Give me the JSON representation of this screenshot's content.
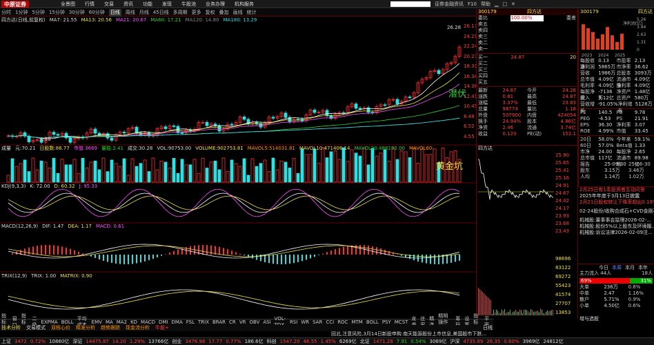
{
  "app": {
    "logo": "中原证券",
    "menu": [
      "全景图",
      "行情",
      "交易",
      "资讯",
      "功能",
      "发现",
      "牛股池",
      "业务办理",
      "机构服务"
    ],
    "top_right": [
      "证券金融资讯",
      "F10",
      "帮助"
    ]
  },
  "periods": [
    "分时",
    "1分钟",
    "5分钟",
    "15分钟",
    "30分钟",
    "60分钟",
    "日线",
    "周线",
    "月线",
    "45日线",
    "多周期",
    "更多",
    "复权",
    "叠加",
    "画线",
    "统计"
  ],
  "active_period": "日线",
  "main_chart": {
    "stock_label": "四方达(日线,前复权)",
    "ma": [
      {
        "label": "MA7: 21.55",
        "color": "#ffffff"
      },
      {
        "label": "MA13: 20.56",
        "color": "#f0e040"
      },
      {
        "label": "MA21: 20.67",
        "color": "#ff50ff"
      },
      {
        "label": "MA60: 17.21",
        "color": "#30d030"
      },
      {
        "label": "MA120: 14.80",
        "color": "#888888"
      },
      {
        "label": "MA180: 13.29",
        "color": "#30d8e0"
      }
    ],
    "high_label": "26.28",
    "low_label": "4.16",
    "annotation": "潜伏",
    "price_axis": [
      "26.17",
      "24.21",
      "22.24",
      "20.27",
      "18.31",
      "16.34",
      "14.38",
      "12.41",
      "10.45",
      "8.48",
      "6.52",
      "4.55"
    ]
  },
  "volume_chart": {
    "title_items": [
      "成量",
      "元:70.21",
      "日股数:86.77",
      "市值:3669",
      "量能:2.41",
      "成交:30.28",
      "VOL:90753.00",
      "VOLUME:902753.81",
      "MAVOL5:514031.81",
      "MAVOL10:471406.14",
      "MAVOL20:486192.00",
      "MAVOL60:"
    ],
    "annotation": "黄金坑"
  },
  "kdj_chart": {
    "title_items": [
      "KDJ(9,3,3)",
      "K: 72.00",
      "D: 60.32",
      "J: 95.33"
    ]
  },
  "macd_chart": {
    "title_items": [
      "MACD(12,26,9)",
      "DIF: 1.47",
      "DEA: 1.17",
      "MACD: 0.61"
    ]
  },
  "trix_chart": {
    "title_items": [
      "TRIX(12,9)",
      "TRIX: 1.00",
      "MATRIX: 0.90"
    ]
  },
  "quote_panel": {
    "code": "300179",
    "name": "四方达",
    "order_ratio_label": "委比",
    "order_ratio": "100.00%",
    "order_diff_label": "委差",
    "ask_labels": [
      "卖五",
      "卖四",
      "卖三",
      "卖二",
      "卖一"
    ],
    "bid_labels": [
      "买一",
      "买二",
      "买三",
      "买四",
      "买五"
    ],
    "bid_one_price": "24.87",
    "bid_one_vol": "20",
    "stats": [
      [
        "最新",
        "24.87",
        "今开",
        "24.28"
      ],
      [
        "涨跌",
        "0.81",
        "最高",
        "24.87"
      ],
      [
        "涨幅",
        "3.37%",
        "最低",
        "23.83"
      ],
      [
        "总量",
        "98774",
        "量比",
        "1.18"
      ],
      [
        "外盘",
        "507900",
        "内盘",
        "424054"
      ],
      [
        "换手",
        "24.94%",
        "股本",
        "4.86亿"
      ],
      [
        "净资",
        "2.46",
        "流通",
        "3.74亿"
      ],
      [
        "收益",
        "0.120",
        "PE(动)",
        "152.1"
      ]
    ]
  },
  "intraday": {
    "title": "四方达",
    "price_axis": [
      "25.90",
      "25.65",
      "25.41",
      "25.16",
      "24.91",
      "24.67",
      "24.42",
      "24.17",
      "23.93",
      "23.68",
      "23.43"
    ],
    "vol_axis": [
      "98696",
      "83122",
      "69272",
      "55423",
      "41574",
      "27707",
      "13853"
    ]
  },
  "news_panel": {
    "items": [
      "2月25日有1条投资者互动问答",
      "2025年年度于3月13日披露",
      "2月21日股权转让下降率超出0.19%...",
      "02-24股份/收购合成石+CVD金刚石...",
      "机械股:董事事会监理2026-02-...",
      "机械股:股份5%以上股东及环境履...",
      "机械股:诉讼法律2026-02-09注..."
    ]
  },
  "far_right": {
    "code": "300179",
    "name": "四方达",
    "bar_years": [
      "2023",
      "2024",
      "2025"
    ],
    "bar_label": "净利润(亿)",
    "bar_axis": [
      "5.26",
      "3.94",
      "2.63",
      "1.31",
      "0"
    ],
    "stats": [
      [
        "每股收益",
        "0.13",
        "市盈率",
        "2.13"
      ],
      [
        "净利润",
        "5865万",
        "市净率",
        "36.62"
      ],
      [
        "营收",
        "1986万",
        "总股本",
        "3093万"
      ],
      [
        "总市值",
        "4.09亿",
        "流通市值",
        "4.09亿"
      ],
      [
        "毛利率",
        "4.09亿",
        "净利率",
        "4.09亿"
      ],
      [
        "每股净资",
        "-7136万",
        "净资产",
        "1.48亿"
      ],
      [
        "收入",
        "9.12亿",
        "总资产",
        "580万"
      ],
      [
        "营收增长",
        "-91.05%",
        "净利增长",
        "5128万"
      ]
    ],
    "valuation": [
      [
        "PE",
        "140.5",
        "PB",
        "9.78"
      ],
      [
        "PEG",
        "-4.53",
        "PS",
        "21.91"
      ],
      [
        "EPS",
        "36.30",
        "净利率",
        "3.07"
      ],
      [
        "ROE",
        "4.99%",
        "市值",
        "33.45"
      ]
    ],
    "holder_stats": [
      [
        "20日",
        "58.0%",
        "今年来",
        "59.1%"
      ],
      [
        "60日",
        "57.0%",
        "Beta值",
        "1.33"
      ],
      [
        "市净",
        "24.00",
        "每股净",
        "2.65"
      ],
      [
        "总市值",
        "117亿",
        "流通市值",
        "89.98亿"
      ]
    ],
    "dates": [
      [
        "报告",
        "25-09-30",
        "25-06-30"
      ],
      [
        "股东",
        "3.15万",
        "3.46万"
      ],
      [
        "人均",
        "1.14万",
        "1.02万"
      ]
    ],
    "flow_tabs": [
      "今日",
      "本周",
      "本月",
      "本年"
    ],
    "flow_labels": [
      "主力流入 44人",
      "18人"
    ],
    "flow_pct": [
      "69%",
      "31%"
    ],
    "flow_rows": [
      [
        "大单",
        "236万",
        "0.6%"
      ],
      [
        "中单",
        "2.47",
        "1.16%"
      ],
      [
        "散户",
        "5.71%",
        "0.9%"
      ],
      [
        "小单",
        "4.50亿",
        "0.6%"
      ]
    ],
    "footer": "增与选股"
  },
  "indicator_tabs": [
    "指标A",
    "窗口",
    "指标B",
    "二级",
    "EXPMA",
    "BOLL",
    "平均成本",
    "EMV",
    "MA",
    "MA2",
    "KD",
    "MACD",
    "DMI",
    "DMA",
    "FSL",
    "TRIX",
    "BRAR",
    "CR",
    "VR",
    "OBV",
    "ASI",
    "VOL-TDX",
    "RSI",
    "WR",
    "SAR",
    "CCI",
    "ROC",
    "MTM",
    "BOLL",
    "PSY",
    "MCST",
    "龙虎",
    "庄家",
    "精选",
    "精明操作盘",
    "筹码",
    "设置",
    "指标A",
    "平面"
  ],
  "bottom_tabs": [
    "技术分析",
    "交易模式",
    "双核心价",
    "精准分析",
    "趋势跟踪",
    "现金流分析",
    "牛股+"
  ],
  "bottom_right": "日线",
  "status_items": [
    {
      "text": "上证",
      "color": "#dddddd"
    },
    {
      "text": "3472",
      "color": "#ff4040"
    },
    {
      "text": "0.72%",
      "color": "#ff4040"
    },
    {
      "text": "10860亿",
      "color": "#dddddd"
    },
    {
      "text": "深证",
      "color": "#dddddd"
    },
    {
      "text": "14475.87",
      "color": "#ff4040"
    },
    {
      "text": "14.20",
      "color": "#ff4040"
    },
    {
      "text": "1.29%",
      "color": "#ff4040"
    },
    {
      "text": "13766亿",
      "color": "#dddddd"
    },
    {
      "text": "创业",
      "color": "#dddddd"
    },
    {
      "text": "3476.98",
      "color": "#ff4040"
    },
    {
      "text": "17.77",
      "color": "#ff4040"
    },
    {
      "text": "0.77%",
      "color": "#ff4040"
    },
    {
      "text": "186.6亿",
      "color": "#dddddd"
    },
    {
      "text": "科创",
      "color": "#dddddd"
    },
    {
      "text": "1547.20",
      "color": "#ff4040"
    },
    {
      "text": "46.55",
      "color": "#ff4040"
    },
    {
      "text": "1.45%",
      "color": "#ff4040"
    },
    {
      "text": "6269亿",
      "color": "#dddddd"
    },
    {
      "text": "北证",
      "color": "#dddddd"
    },
    {
      "text": "1471.28",
      "color": "#ff4040"
    },
    {
      "text": "7.91",
      "color": "#30d030"
    },
    {
      "text": "0.54%",
      "color": "#30d030"
    },
    {
      "text": "3069亿",
      "color": "#dddddd"
    },
    {
      "text": "沪深",
      "color": "#dddddd"
    },
    {
      "text": "4735.89",
      "color": "#ff4040"
    },
    {
      "text": "26.35",
      "color": "#ff4040"
    },
    {
      "text": "0.60%",
      "color": "#ff4040"
    },
    {
      "text": "3969亿",
      "color": "#dddddd"
    },
    {
      "text": "24812亿",
      "color": "#dddddd"
    }
  ],
  "ticker": "回北,注意风险,3月14日新股申购:南天能源股份上市信息,美国股市下跌..."
}
